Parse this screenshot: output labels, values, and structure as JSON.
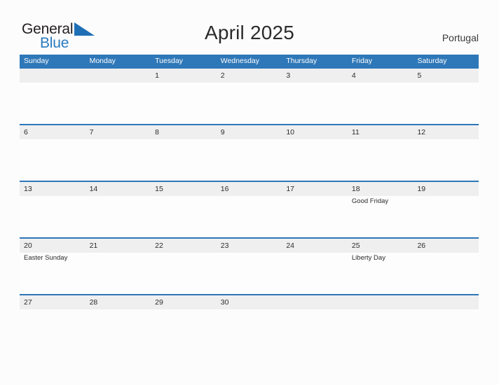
{
  "brand": {
    "name_dark": "General",
    "name_blue": "Blue",
    "flag_icon": "blue-flag-triangle-icon",
    "accent_color": "#2a7ac0"
  },
  "header": {
    "title": "April 2025",
    "country": "Portugal"
  },
  "calendar": {
    "header_bg_color": "#2e77b8",
    "date_band_color": "#efefef",
    "weekdays": [
      "Sunday",
      "Monday",
      "Tuesday",
      "Wednesday",
      "Thursday",
      "Friday",
      "Saturday"
    ],
    "weeks": [
      [
        {
          "day": "",
          "event": ""
        },
        {
          "day": "",
          "event": ""
        },
        {
          "day": "1",
          "event": ""
        },
        {
          "day": "2",
          "event": ""
        },
        {
          "day": "3",
          "event": ""
        },
        {
          "day": "4",
          "event": ""
        },
        {
          "day": "5",
          "event": ""
        }
      ],
      [
        {
          "day": "6",
          "event": ""
        },
        {
          "day": "7",
          "event": ""
        },
        {
          "day": "8",
          "event": ""
        },
        {
          "day": "9",
          "event": ""
        },
        {
          "day": "10",
          "event": ""
        },
        {
          "day": "11",
          "event": ""
        },
        {
          "day": "12",
          "event": ""
        }
      ],
      [
        {
          "day": "13",
          "event": ""
        },
        {
          "day": "14",
          "event": ""
        },
        {
          "day": "15",
          "event": ""
        },
        {
          "day": "16",
          "event": ""
        },
        {
          "day": "17",
          "event": ""
        },
        {
          "day": "18",
          "event": "Good Friday"
        },
        {
          "day": "19",
          "event": ""
        }
      ],
      [
        {
          "day": "20",
          "event": "Easter Sunday"
        },
        {
          "day": "21",
          "event": ""
        },
        {
          "day": "22",
          "event": ""
        },
        {
          "day": "23",
          "event": ""
        },
        {
          "day": "24",
          "event": ""
        },
        {
          "day": "25",
          "event": "Liberty Day"
        },
        {
          "day": "26",
          "event": ""
        }
      ],
      [
        {
          "day": "27",
          "event": ""
        },
        {
          "day": "28",
          "event": ""
        },
        {
          "day": "29",
          "event": ""
        },
        {
          "day": "30",
          "event": ""
        },
        {
          "day": "",
          "event": ""
        },
        {
          "day": "",
          "event": ""
        },
        {
          "day": "",
          "event": ""
        }
      ]
    ]
  }
}
